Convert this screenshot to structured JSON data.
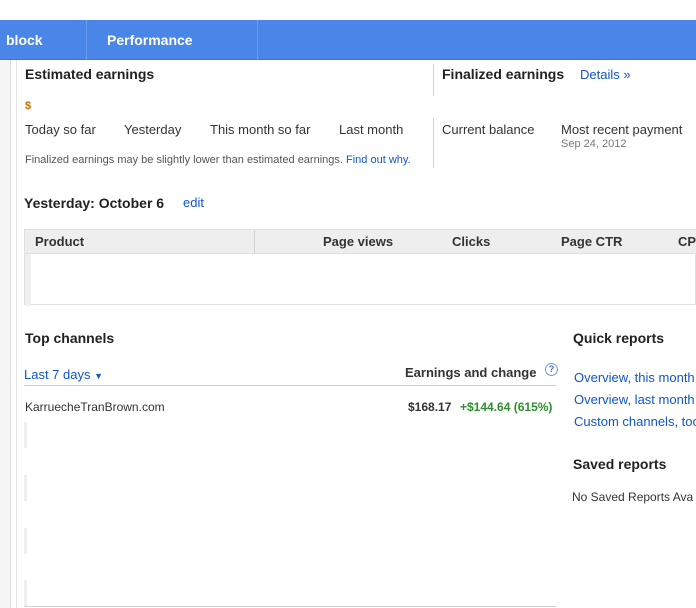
{
  "nav": {
    "tabs": [
      {
        "label": "block ads"
      },
      {
        "label": "Performance reports"
      }
    ]
  },
  "estimated": {
    "title": "Estimated earnings",
    "dollar": "$",
    "periods": [
      "Today so far",
      "Yesterday",
      "This month so far",
      "Last month"
    ],
    "note": "Finalized earnings may be slightly lower than estimated earnings.",
    "note_link": "Find out why."
  },
  "finalized": {
    "title": "Finalized earnings",
    "details_link": "Details »",
    "current_balance": "Current balance",
    "recent_payment": "Most recent payment",
    "recent_payment_date": "Sep 24, 2012"
  },
  "yesterday": {
    "title": "Yesterday: October 6",
    "edit_link": "edit"
  },
  "table": {
    "columns": [
      "Product",
      "Page views",
      "Clicks",
      "Page CTR",
      "CP"
    ]
  },
  "top_channels": {
    "title": "Top channels",
    "range_label": "Last 7 days",
    "earnings_header": "Earnings and change",
    "help": "?",
    "rows": [
      {
        "name": "KarruecheTranBrown.com",
        "earnings": "$168.17",
        "change": "+$144.64 (615%)"
      }
    ]
  },
  "quick_reports": {
    "title": "Quick reports",
    "links": [
      "Overview, this month",
      "Overview, last month",
      "Custom channels, too"
    ]
  },
  "saved_reports": {
    "title": "Saved reports",
    "empty": "No Saved Reports Ava"
  },
  "colors": {
    "nav_bg": "#4a86e8",
    "link": "#1155cc",
    "positive": "#2f8f2f"
  }
}
